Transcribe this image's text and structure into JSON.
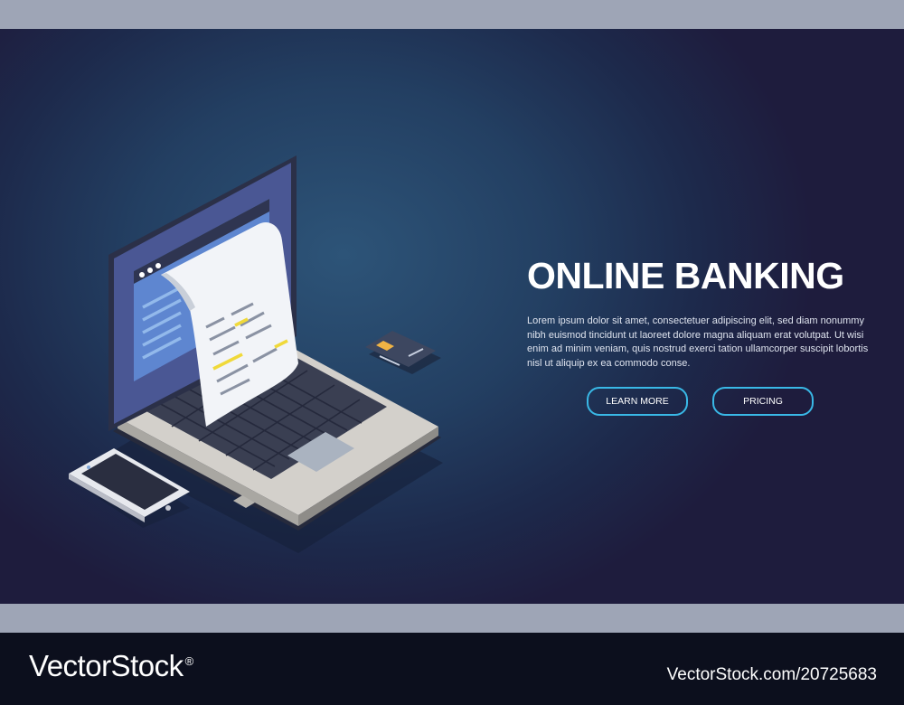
{
  "banner": {
    "title": "ONLINE BANKING",
    "description": "Lorem ipsum dolor sit amet, consectetuer adipiscing elit, sed diam nonummy nibh euismod tincidunt ut laoreet dolore magna aliquam erat volutpat. Ut wisi enim ad minim veniam, quis nostrud exerci tation ullamcorper suscipit lobortis nisl ut aliquip ex ea commodo conse.",
    "buttons": {
      "learn_more": "LEARN MORE",
      "pricing": "PRICING"
    }
  },
  "footer": {
    "brand": "VectorStock",
    "registered_mark": "®",
    "stock_id": "VectorStock.com/20725683"
  },
  "colors": {
    "accent": "#39b8e6",
    "background_dark": "#1e1c3d",
    "background_light": "#2d5478",
    "receipt_highlight": "#f0d93a"
  }
}
